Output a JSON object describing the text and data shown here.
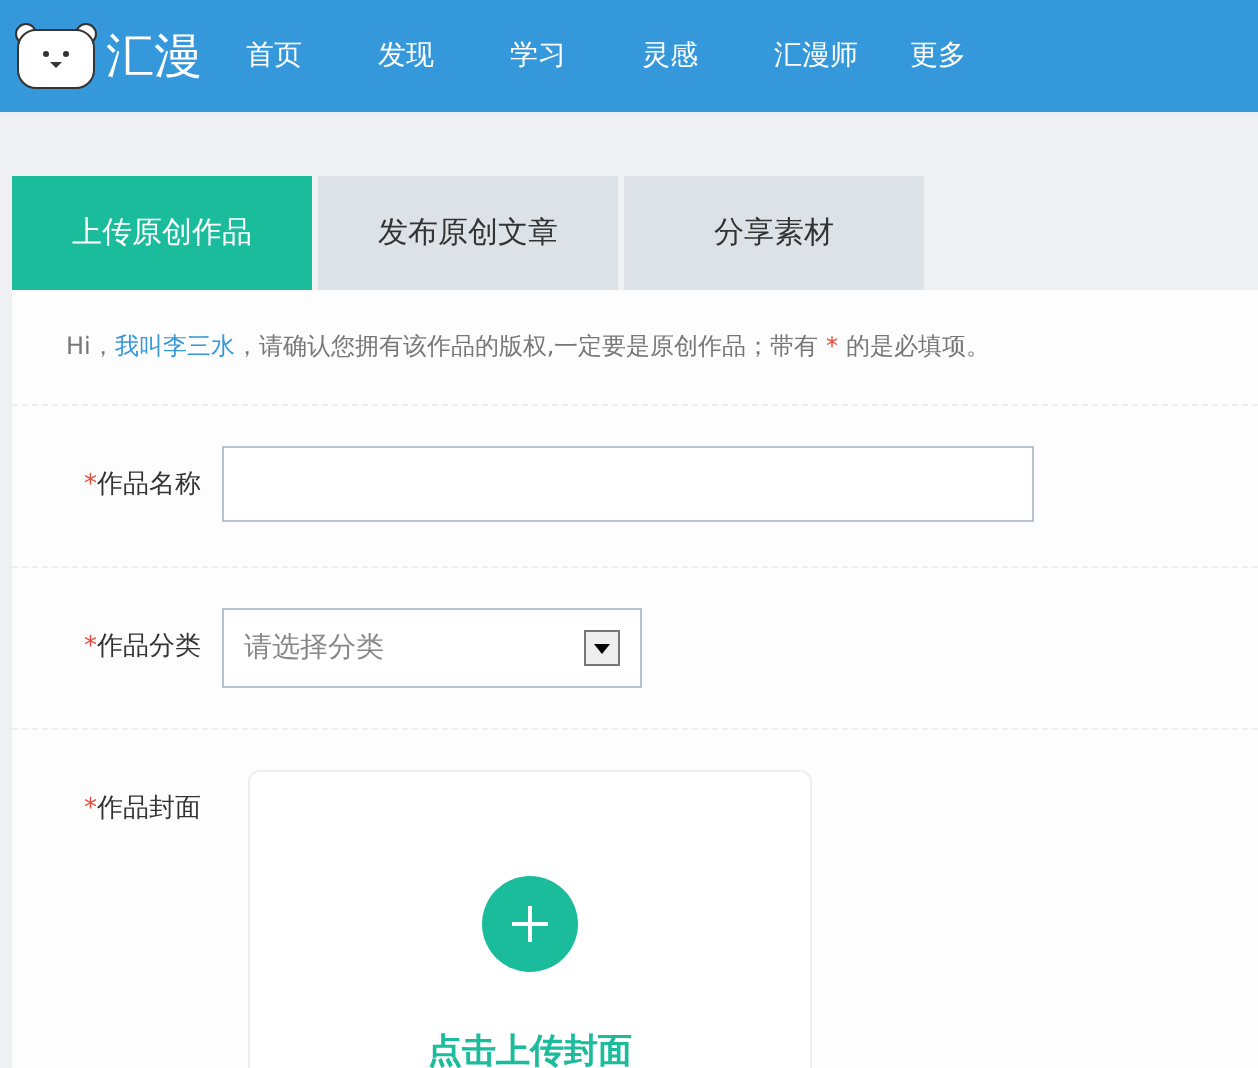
{
  "header": {
    "logo_text": "汇漫",
    "nav": [
      {
        "label": "首页"
      },
      {
        "label": "发现"
      },
      {
        "label": "学习"
      },
      {
        "label": "灵感"
      },
      {
        "label": "汇漫师"
      },
      {
        "label": "更多"
      }
    ]
  },
  "tabs": [
    {
      "label": "上传原创作品",
      "selected": true
    },
    {
      "label": "发布原创文章",
      "selected": false
    },
    {
      "label": "分享素材",
      "selected": false
    }
  ],
  "intro": [
    {
      "kind": "text",
      "text": "Hi，"
    },
    {
      "kind": "link",
      "text": "我叫李三水"
    },
    {
      "kind": "text",
      "text": "，请确认您拥有该作品的版权,一定要是原创作品；带有 "
    },
    {
      "kind": "mark",
      "text": "*"
    },
    {
      "kind": "text",
      "text": " 的是必填项。"
    }
  ],
  "fields": [
    {
      "kind": "input",
      "mark": "*",
      "label": "作品名称"
    },
    {
      "kind": "select",
      "mark": "*",
      "label": "作品分类",
      "placeholder": "请选择分类"
    },
    {
      "kind": "upload",
      "mark": "*",
      "label": "作品封面",
      "action": "点击上传封面"
    }
  ]
}
